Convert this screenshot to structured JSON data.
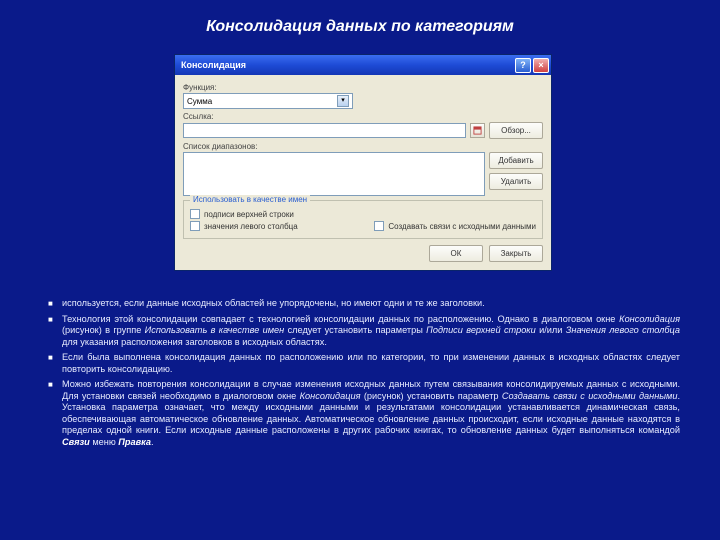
{
  "slide": {
    "title": "Консолидация данных по категориям"
  },
  "dialog": {
    "title": "Консолидация",
    "labels": {
      "function": "Функция:",
      "reference": "Ссылка:",
      "list": "Список диапазонов:",
      "group": "Использовать в качестве имен"
    },
    "function_value": "Сумма",
    "buttons": {
      "browse": "Обзор...",
      "add": "Добавить",
      "delete": "Удалить",
      "ok": "ОК",
      "close": "Закрыть"
    },
    "checks": {
      "top_row": "подписи верхней строки",
      "left_col": "значения левого столбца",
      "links": "Создавать связи с исходными данными"
    }
  },
  "bullets": {
    "b1": "используется, если данные исходных областей не упорядочены, но имеют одни и те же заголовки.",
    "b2a": "Технология этой консолидации совпадает с технологией консолидации данных по расположению. Однако в диалоговом окне ",
    "b2b": "Консолидация",
    "b2c": " (рисунок) в группе ",
    "b2d": "Использовать в качестве имен",
    "b2e": " следует установить параметры ",
    "b2f": "Подписи верхней строки",
    "b2g": " и/или ",
    "b2h": "Значения левого столбца",
    "b2i": " для указания расположения заголовков в исходных областях.",
    "b3": "Если была выполнена консолидация данных по расположению или по категории, то при изменении данных в исходных областях следует повторить консолидацию.",
    "b4a": "Можно избежать повторения консолидации в случае изменения исходных данных путем связывания консолидируемых данных с исходными. Для установки связей необходимо в диалоговом окне ",
    "b4b": "Консолидация",
    "b4c": " (рисунок) установить параметр ",
    "b4d": "Создавать связи с исходными данными",
    "b4e": ". Установка параметра означает, что между исходными данными и результатами консолидации устанавливается динамическая связь, обеспечивающая автоматическое обновление данных. Автоматическое обновление данных происходит, если исходные данные находятся в пределах одной книги. Если исходные данные расположены в других рабочих книгах, то обновление данных будет выполняться командой ",
    "b4f": "Связи",
    "b4g": " меню ",
    "b4h": "Правка",
    "b4i": "."
  }
}
